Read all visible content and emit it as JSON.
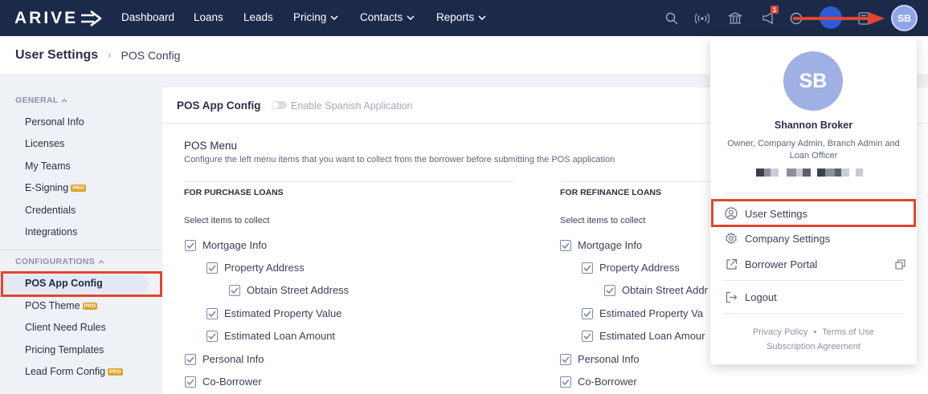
{
  "nav": {
    "logo": "ARIVE",
    "items": [
      {
        "label": "Dashboard",
        "dropdown": false
      },
      {
        "label": "Loans",
        "dropdown": false
      },
      {
        "label": "Leads",
        "dropdown": false
      },
      {
        "label": "Pricing",
        "dropdown": true
      },
      {
        "label": "Contacts",
        "dropdown": true
      },
      {
        "label": "Reports",
        "dropdown": true
      }
    ],
    "icons": [
      "search-icon",
      "broadcast-icon",
      "bank-icon",
      "announcement-icon",
      "help-icon",
      "alert-icon",
      "calculator-icon"
    ],
    "announcement_badge": "1",
    "avatar_initials": "SB",
    "accent": "#1c2a4a"
  },
  "breadcrumb": {
    "title": "User Settings",
    "current": "POS Config"
  },
  "sidebar": {
    "general_heading": "GENERAL",
    "general_items": [
      {
        "label": "Personal Info",
        "pro": false
      },
      {
        "label": "Licenses",
        "pro": false
      },
      {
        "label": "My Teams",
        "pro": false
      },
      {
        "label": "E-Signing",
        "pro": true
      },
      {
        "label": "Credentials",
        "pro": false
      },
      {
        "label": "Integrations",
        "pro": false
      }
    ],
    "config_heading": "CONFIGURATIONS",
    "config_items": [
      {
        "label": "POS App Config",
        "pro": false,
        "active": true
      },
      {
        "label": "POS Theme",
        "pro": true
      },
      {
        "label": "Client Need Rules",
        "pro": false
      },
      {
        "label": "Pricing Templates",
        "pro": false
      },
      {
        "label": "Lead Form Config",
        "pro": true
      }
    ],
    "pro_label": "PRO"
  },
  "main": {
    "title": "POS App Config",
    "spanish_toggle_label": "Enable Spanish Application",
    "spanish_toggle_on": false,
    "menu_title": "POS Menu",
    "menu_desc": "Configure the left menu items that you want to collect from the borrower before submitting the POS application",
    "purchase": {
      "heading": "FOR PURCHASE LOANS",
      "sub": "Select items to collect",
      "items": [
        "Mortgage Info",
        "Property Address",
        "Obtain Street Address",
        "Estimated Property Value",
        "Estimated Loan Amount",
        "Personal Info",
        "Co-Borrower"
      ]
    },
    "refinance": {
      "heading": "FOR REFINANCE LOANS",
      "sub": "Select items to collect",
      "items": [
        "Mortgage Info",
        "Property Address",
        "Obtain Street Addr",
        "Estimated Property Va",
        "Estimated Loan Amour",
        "Personal Info",
        "Co-Borrower"
      ]
    }
  },
  "dropdown": {
    "initials": "SB",
    "name": "Shannon Broker",
    "roles": "Owner, Company Admin, Branch Admin and Loan Officer",
    "items": {
      "user_settings": "User Settings",
      "company_settings": "Company Settings",
      "borrower_portal": "Borrower Portal",
      "logout": "Logout"
    },
    "footer": {
      "privacy": "Privacy Policy",
      "dot": "•",
      "terms": "Terms of Use",
      "subscription": "Subscription Agreement"
    }
  },
  "highlight_color": "#e0452f"
}
